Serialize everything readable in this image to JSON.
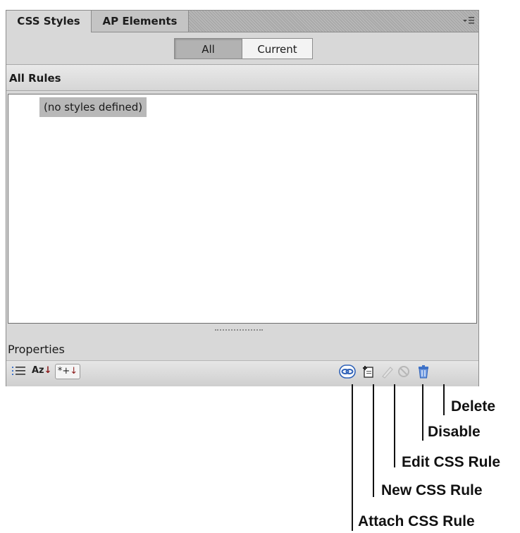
{
  "tabs": [
    {
      "label": "CSS Styles",
      "active": true
    },
    {
      "label": "AP Elements",
      "active": false
    }
  ],
  "toggle": {
    "all_label": "All",
    "current_label": "Current",
    "selected": "All"
  },
  "rules": {
    "header": "All Rules",
    "empty_text": "(no styles defined)"
  },
  "properties": {
    "label": "Properties"
  },
  "view_buttons": {
    "category_icon": "category-view-icon",
    "alpha_icon": "alpha-view-icon",
    "alpha_text": "Az",
    "set_props_text": "*+"
  },
  "callouts": {
    "delete": "Delete",
    "disable": "Disable",
    "edit": "Edit CSS Rule",
    "new": "New CSS Rule",
    "attach": "Attach CSS Rule"
  },
  "colors": {
    "panel": "#d8d8d8",
    "accent_blue": "#3f73c9",
    "arrow_red": "#8b1a1a"
  }
}
